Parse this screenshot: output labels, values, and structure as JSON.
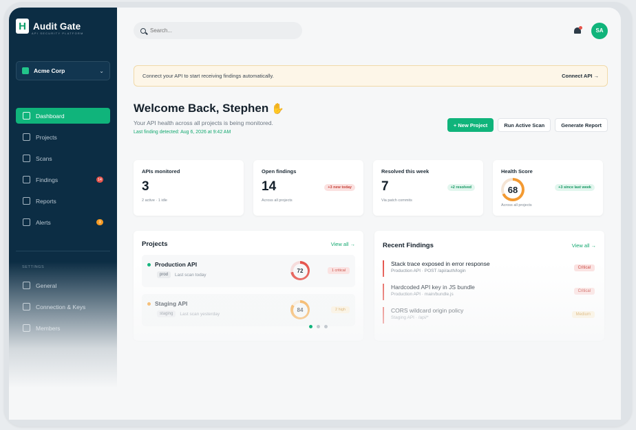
{
  "app": {
    "name": "Audit Gate",
    "tagline": "API SECURITY PLATFORM"
  },
  "org": {
    "name": "Acme Corp"
  },
  "nav": [
    {
      "label": "Dashboard",
      "icon": "grid-icon",
      "active": true
    },
    {
      "label": "Projects",
      "icon": "folder-icon"
    },
    {
      "label": "Scans",
      "icon": "scan-icon"
    },
    {
      "label": "Findings",
      "icon": "warning-icon",
      "badge": "14"
    },
    {
      "label": "Reports",
      "icon": "clipboard-icon"
    },
    {
      "label": "Alerts",
      "icon": "bell-icon",
      "badge": "3"
    }
  ],
  "settings": {
    "title": "SETTINGS",
    "items": [
      {
        "label": "General"
      },
      {
        "label": "Connection & Keys"
      },
      {
        "label": "Members"
      }
    ]
  },
  "search": {
    "placeholder": "Search..."
  },
  "user": {
    "initials": "SA"
  },
  "banner": {
    "text": "Connect your API to start receiving findings automatically.",
    "link": "Connect API →"
  },
  "welcome": {
    "title": "Welcome Back, Stephen",
    "subtitle": "Your API health across all projects is being monitored.",
    "last": "Last finding detected: Aug 6, 2026 at 9:42 AM"
  },
  "actions": {
    "new_project": "+ New Project",
    "run_scan": "Run Active Scan",
    "report": "Generate Report"
  },
  "stats": [
    {
      "label": "APIs monitored",
      "value": "3",
      "foot": "2 active · 1 idle"
    },
    {
      "label": "Open findings",
      "value": "14",
      "foot": "Across all projects",
      "pill": "+3 new today"
    },
    {
      "label": "Resolved this week",
      "value": "7",
      "foot": "Via patch commits",
      "pill": "+2 resolved"
    },
    {
      "label": "Health Score",
      "value": "68",
      "foot": "Across all projects",
      "pill": "+3 since last week"
    }
  ],
  "projects": {
    "title": "Projects",
    "view_all": "View all →",
    "items": [
      {
        "name": "Production API",
        "tag": "prod",
        "scan": "Last scan today",
        "score": "72",
        "crit": "1 critical"
      },
      {
        "name": "Staging API",
        "tag": "staging",
        "scan": "Last scan yesterday",
        "score": "84",
        "crit": "2 high"
      }
    ]
  },
  "findings": {
    "title": "Recent Findings",
    "view_all": "View all →",
    "items": [
      {
        "title": "Stack trace exposed in error response",
        "path": "Production API · POST /api/auth/login",
        "sev": "Critical"
      },
      {
        "title": "Hardcoded API key in JS bundle",
        "path": "Production API · main/bundle.js",
        "sev": "Critical"
      },
      {
        "title": "CORS wildcard origin policy",
        "path": "Staging API · /api/*",
        "sev": "Medium"
      }
    ]
  },
  "colors": {
    "accent": "#10b47b",
    "sidebar": "#0c2d44",
    "critical": "#e5534b",
    "warning": "#f59a23"
  }
}
